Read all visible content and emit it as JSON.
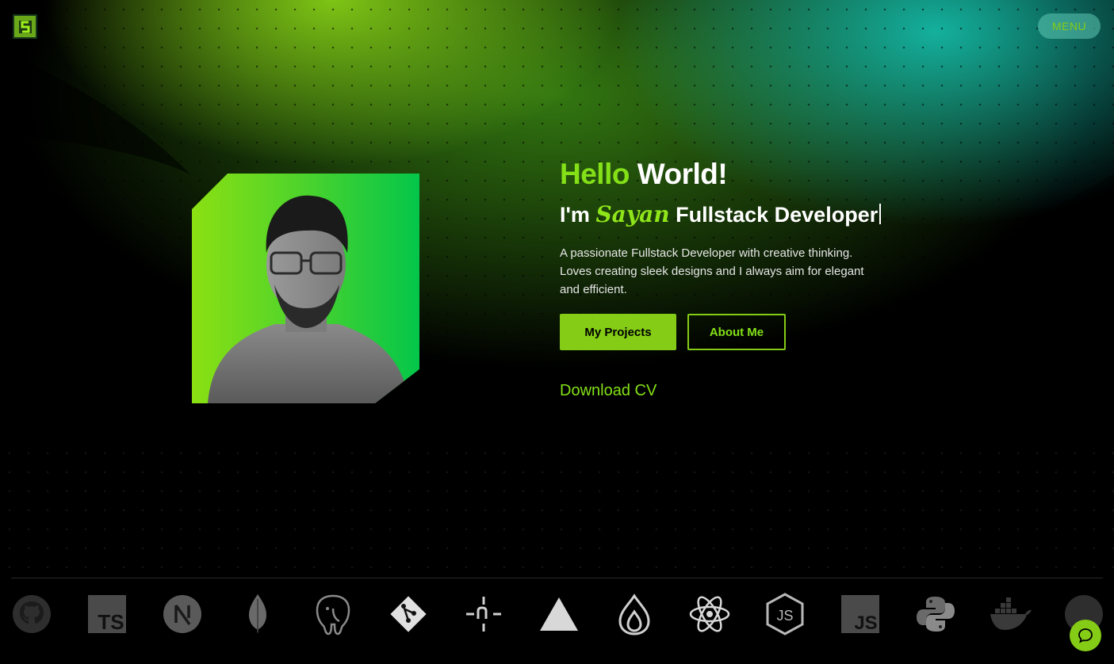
{
  "header": {
    "logo_icon": "s-monogram-icon",
    "menu_label": "MENU"
  },
  "hero": {
    "hello": "Hello",
    "world": "World!",
    "im": "I'm",
    "name": "Sayan",
    "role": "Fullstack Developer",
    "description": "A passionate Fullstack Developer with creative thinking. Loves creating sleek designs and I always aim for elegant and efficient.",
    "primary_button": "My Projects",
    "secondary_button": "About Me",
    "download_link": "Download CV"
  },
  "tech_stack": [
    {
      "name": "github-icon"
    },
    {
      "name": "typescript-icon",
      "label": "TS"
    },
    {
      "name": "nextjs-icon",
      "label": "N"
    },
    {
      "name": "mongodb-icon"
    },
    {
      "name": "postgresql-icon"
    },
    {
      "name": "git-icon"
    },
    {
      "name": "netlify-icon",
      "label": "n"
    },
    {
      "name": "vercel-icon"
    },
    {
      "name": "sanity-icon"
    },
    {
      "name": "react-icon"
    },
    {
      "name": "nodejs-icon",
      "label": "JS"
    },
    {
      "name": "javascript-icon",
      "label": "JS"
    },
    {
      "name": "python-icon"
    },
    {
      "name": "docker-icon"
    },
    {
      "name": "github-icon"
    }
  ],
  "chat": {
    "icon": "chat-bubble-icon"
  },
  "colors": {
    "accent": "#84cc16",
    "accent_bright": "#84e017",
    "teal": "#14b8a6",
    "background": "#000000"
  }
}
